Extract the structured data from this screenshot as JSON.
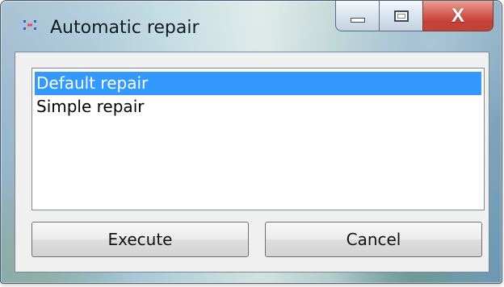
{
  "window": {
    "title": "Automatic repair",
    "controls": {
      "close_label": "X"
    }
  },
  "repair_options": [
    {
      "label": "Default repair",
      "selected": true
    },
    {
      "label": "Simple repair",
      "selected": false
    }
  ],
  "buttons": {
    "execute": "Execute",
    "cancel": "Cancel"
  },
  "icons": {
    "app": "repair-icon",
    "minimize": "minimize-icon",
    "maximize": "maximize-icon",
    "close": "close-icon"
  },
  "colors": {
    "selection": "#3399ff",
    "close_button": "#c63f34"
  }
}
